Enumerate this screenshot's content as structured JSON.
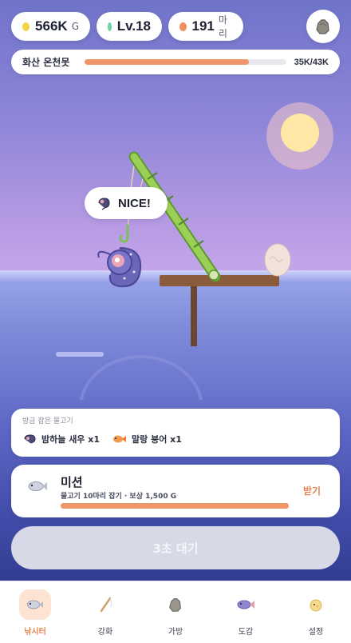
{
  "header": {
    "gold": {
      "value": "566K",
      "unit": "G",
      "dot_color": "#f4d548"
    },
    "level": {
      "value": "Lv.18",
      "dot_color": "#6cd3a2"
    },
    "fish_count": {
      "value": "191",
      "unit": "마리",
      "dot_color": "#f0905e"
    },
    "bag_icon": "stone-bag-icon"
  },
  "location": {
    "name": "화산 온천못",
    "progress_text": "35K/43K",
    "progress": 0.814,
    "bar_color": "#ef956a"
  },
  "scene": {
    "bubble_text": "NICE!",
    "bubble_icon": "shrimp-icon",
    "sun_color": "#ffe7a6"
  },
  "recent_catch": {
    "title": "방금 잡은 물고기",
    "items": [
      {
        "name": "밤하늘 새우 x1",
        "icon": "night-shrimp-icon"
      },
      {
        "name": "말랑 붕어 x1",
        "icon": "orange-goldfish-icon"
      }
    ]
  },
  "mission": {
    "title": "미션",
    "description": "물고기 10마리 잡기 · 보상 1,500 G",
    "claim_label": "받기",
    "progress": 1.0,
    "icon": "silver-fish-icon"
  },
  "action_button": {
    "label": "3초 대기"
  },
  "nav": {
    "items": [
      {
        "label": "낚시터",
        "icon": "fish-icon",
        "active": true
      },
      {
        "label": "강화",
        "icon": "fishing-rod-icon",
        "active": false
      },
      {
        "label": "가방",
        "icon": "bag-icon",
        "active": false
      },
      {
        "label": "도감",
        "icon": "collection-fish-icon",
        "active": false
      },
      {
        "label": "설정",
        "icon": "chick-icon",
        "active": false
      }
    ]
  },
  "colors": {
    "accent": "#e8844e",
    "active_tab_bg": "#fde3d1",
    "button_disabled": "#d7dae6"
  }
}
